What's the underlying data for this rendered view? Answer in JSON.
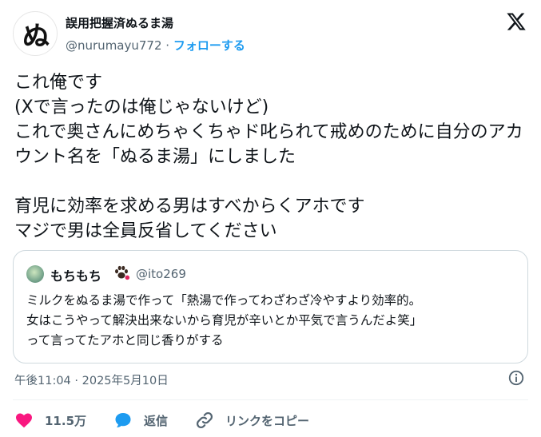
{
  "author": {
    "avatar_text": "ぬ",
    "display_name": "誤用把握済ぬるま湯",
    "handle": "@nurumayu772",
    "separator": "·",
    "follow_label": "フォローする"
  },
  "tweet": {
    "text": "これ俺です\n(Xで言ったのは俺じゃないけど)\nこれで奥さんにめちゃくちゃド叱られて戒めのために自分のアカウント名を「ぬるま湯」にしました\n\n育児に効率を求める男はすべからくアホです\nマジで男は全員反省してください"
  },
  "quoted": {
    "display_name": "もちもち",
    "handle": "@ito269",
    "text": "ミルクをぬるま湯で作って「熱湯で作ってわざわざ冷やすより効率的。\n女はこうやって解決出来ないから育児が辛いとか平気で言うんだよ笑」\nって言ってたアホと同じ香りがする"
  },
  "timestamp": "午後11:04 · 2025年5月10日",
  "actions": {
    "likes": "11.5万",
    "reply_label": "返信",
    "copy_link_label": "リンクをコピー"
  },
  "colors": {
    "like": "#f91880",
    "reply": "#1d9bf0",
    "link_icon": "#536471",
    "follow": "#1d9bf0"
  }
}
